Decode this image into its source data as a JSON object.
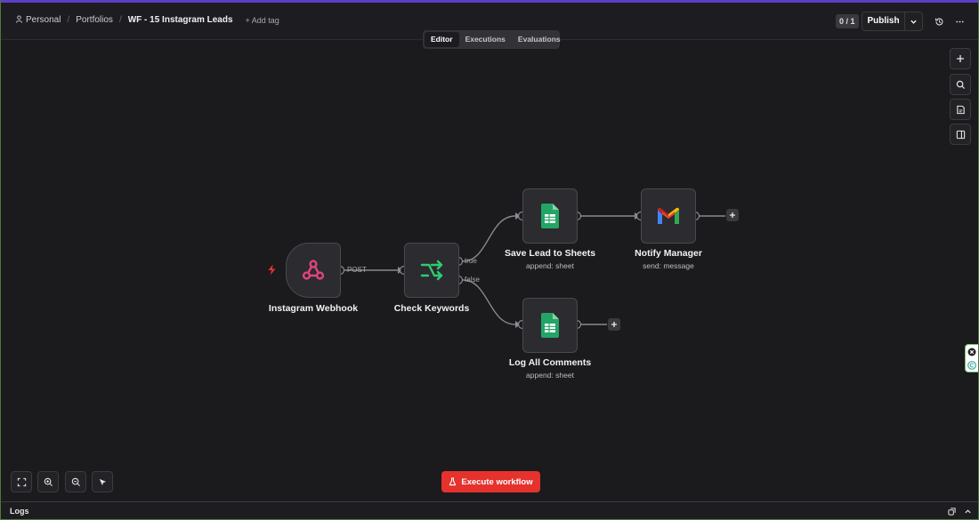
{
  "header": {
    "breadcrumbs": [
      "Personal",
      "Portfolios",
      "WF - 15 Instagram Leads"
    ],
    "add_tag": "+ Add tag",
    "counter": "0 / 1",
    "publish_label": "Publish"
  },
  "tabs": [
    {
      "label": "Editor",
      "active": true
    },
    {
      "label": "Executions",
      "active": false
    },
    {
      "label": "Evaluations",
      "active": false
    }
  ],
  "nodes": {
    "webhook": {
      "label": "Instagram Webhook",
      "icon": "webhook-icon"
    },
    "check": {
      "label": "Check Keywords",
      "icon": "if-branch-icon"
    },
    "save": {
      "label": "Save Lead to Sheets",
      "subtitle": "append: sheet",
      "icon": "google-sheets-icon"
    },
    "notify": {
      "label": "Notify Manager",
      "subtitle": "send: message",
      "icon": "gmail-icon"
    },
    "log": {
      "label": "Log All Comments",
      "subtitle": "append: sheet",
      "icon": "google-sheets-icon"
    }
  },
  "edges": {
    "post": "POST",
    "true": "true",
    "false": "false"
  },
  "execute_label": "Execute workflow",
  "logs_label": "Logs",
  "colors": {
    "accent_red": "#e5322d",
    "top_stripe": "#5b3fc4",
    "webhook_pink": "#e0457b",
    "if_green": "#2ecc71",
    "sheets_green": "#23a566"
  }
}
